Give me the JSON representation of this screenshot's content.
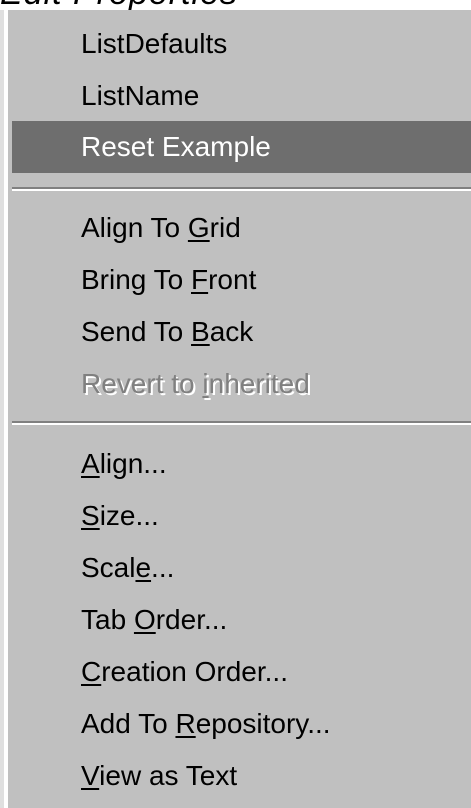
{
  "top_strip_text": "Edit Properties",
  "menu": {
    "items": [
      {
        "label": "ListDefaults"
      },
      {
        "label": "ListName"
      },
      {
        "label": "Reset Example",
        "highlighted": true
      },
      {
        "pre": "Align To ",
        "u": "G",
        "post": "rid"
      },
      {
        "pre": "Bring To ",
        "u": "F",
        "post": "ront"
      },
      {
        "pre": "Send To ",
        "u": "B",
        "post": "ack"
      },
      {
        "pre": "Revert to ",
        "u": "i",
        "post": "nherited",
        "disabled": true
      },
      {
        "pre": "",
        "u": "A",
        "post": "lign..."
      },
      {
        "pre": "",
        "u": "S",
        "post": "ize..."
      },
      {
        "pre": "Scal",
        "u": "e",
        "post": "..."
      },
      {
        "pre": "Tab ",
        "u": "O",
        "post": "rder..."
      },
      {
        "pre": "",
        "u": "C",
        "post": "reation Order..."
      },
      {
        "pre": "Add To ",
        "u": "R",
        "post": "epository..."
      },
      {
        "pre": "",
        "u": "V",
        "post": "iew as Text"
      }
    ]
  }
}
